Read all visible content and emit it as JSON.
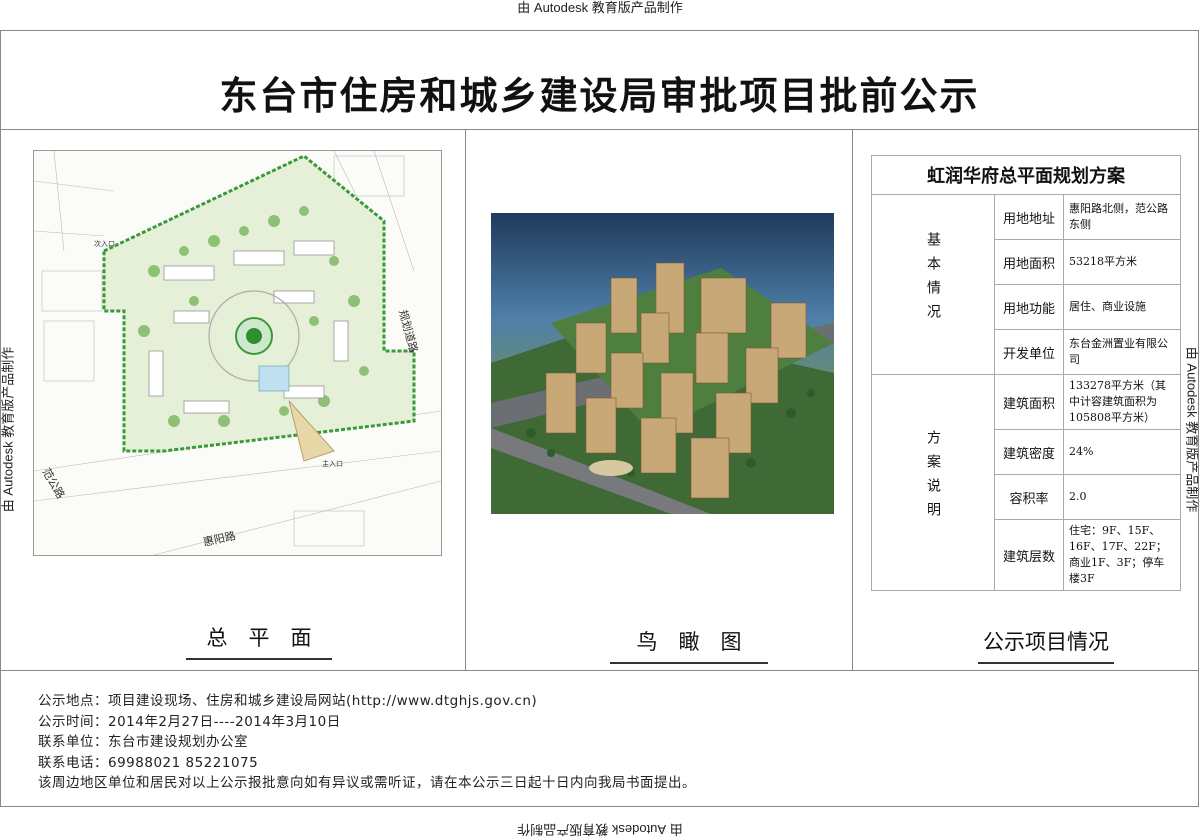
{
  "watermark": "由 Autodesk 教育版产品制作",
  "title": "东台市住房和城乡建设局审批项目批前公示",
  "captions": {
    "plan": "总　平　面",
    "aerial": "鸟　瞰　图",
    "info": "公示项目情况"
  },
  "plan_labels": {
    "road_east": "规划道路",
    "road_left": "范公路",
    "road_bottom": "惠阳路",
    "entrance_top": "次入口",
    "entrance_bottom": "主入口"
  },
  "info_table": {
    "heading": "虹润华府总平面规划方案",
    "group_basic": "基本情况",
    "group_scheme": "方案说明",
    "basic": [
      {
        "key": "用地地址",
        "value": "惠阳路北侧，范公路东侧"
      },
      {
        "key": "用地面积",
        "value": "53218平方米"
      },
      {
        "key": "用地功能",
        "value": "居住、商业设施"
      },
      {
        "key": "开发单位",
        "value": "东台金洲置业有限公司"
      }
    ],
    "scheme": [
      {
        "key": "建筑面积",
        "value": "133278平方米（其中计容建筑面积为105808平方米）"
      },
      {
        "key": "建筑密度",
        "value": "24%"
      },
      {
        "key": "容积率",
        "value": "2.0"
      },
      {
        "key": "建筑层数",
        "value": "住宅：9F、15F、16F、17F、22F；商业1F、3F；停车楼3F"
      }
    ]
  },
  "footer": {
    "line1": "公示地点：项目建设现场、住房和城乡建设局网站(http://www.dtghjs.gov.cn)",
    "line2": "公示时间：2014年2月27日----2014年3月10日",
    "line3": "联系单位：东台市建设规划办公室",
    "line4": "联系电话：69988021  85221075",
    "line5": "该周边地区单位和居民对以上公示报批意向如有异议或需听证，请在本公示三日起十日内向我局书面提出。"
  }
}
